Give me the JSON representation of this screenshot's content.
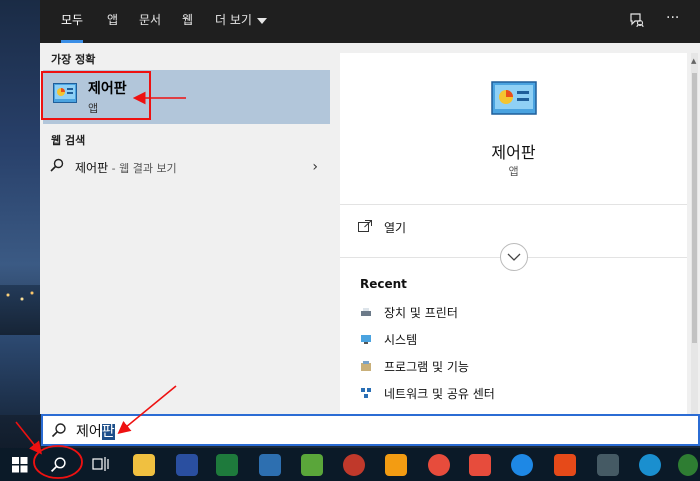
{
  "tabs": [
    {
      "label": "모두"
    },
    {
      "label": "앱"
    },
    {
      "label": "문서"
    },
    {
      "label": "웹"
    },
    {
      "label": "더 보기"
    }
  ],
  "top_icons": {
    "feedback": "feedback-icon",
    "more": "···"
  },
  "best_match": {
    "header": "가장 정확",
    "title": "제어판",
    "subtitle": "앱"
  },
  "web_search": {
    "header": "웹 검색",
    "query": "제어판",
    "suffix": " - 웹 결과 보기"
  },
  "preview": {
    "title": "제어판",
    "subtitle": "앱",
    "open_label": "열기",
    "recent_header": "Recent",
    "recent_items": [
      {
        "label": "장치 및 프린터",
        "icon": "devices-printers-icon"
      },
      {
        "label": "시스템",
        "icon": "system-icon"
      },
      {
        "label": "프로그램 및 기능",
        "icon": "programs-features-icon"
      },
      {
        "label": "네트워크 및 공유 센터",
        "icon": "network-sharing-icon"
      }
    ]
  },
  "search": {
    "typed_prefix": "제어",
    "typed_selected": "판"
  },
  "taskbar_apps": [
    "file-explorer-icon",
    "scanner-icon",
    "excel-icon",
    "app-icon",
    "app-green-icon",
    "app-red-icon",
    "app-orange-icon",
    "app-red2-icon",
    "windows-tiles-icon",
    "teamviewer-icon",
    "microphone-icon",
    "app-dark-icon",
    "edge-icon",
    "chrome-icon",
    "app-blue-icon"
  ],
  "colors": {
    "accent": "#3a8ee6",
    "selection": "#b2c6da",
    "annotation": "#e11111"
  }
}
